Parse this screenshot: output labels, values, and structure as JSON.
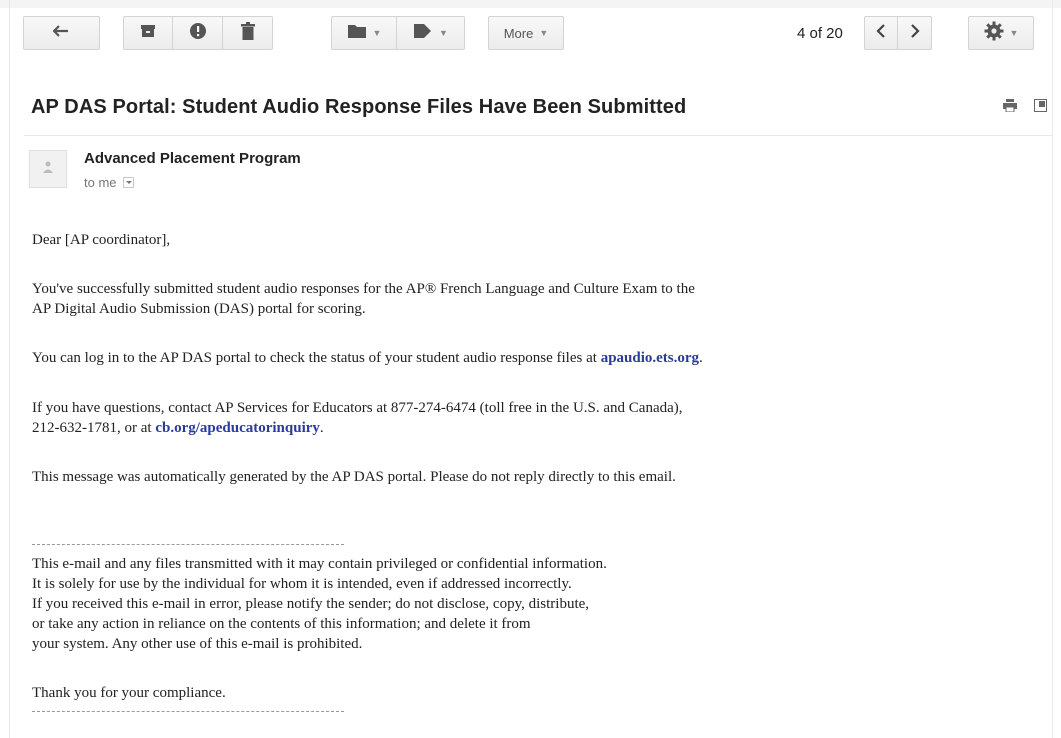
{
  "toolbar": {
    "back_icon": "arrow-left-icon",
    "archive_icon": "archive-icon",
    "spam_icon": "report-spam-icon",
    "delete_icon": "trash-icon",
    "folder_icon": "folder-icon",
    "label_icon": "tag-icon",
    "more_label": "More",
    "pager": "4 of 20",
    "settings_icon": "gear-icon"
  },
  "email": {
    "subject": "AP DAS Portal: Student Audio Response Files Have Been Submitted",
    "sender": "Advanced Placement Program",
    "recipient": "to me",
    "greeting": "Dear [AP coordinator],",
    "para1_line1": "You've successfully submitted student audio responses for the AP® French Language and Culture Exam to the",
    "para1_line2": "AP Digital Audio Submission (DAS) portal for scoring.",
    "para2_text": "You can log in to the AP DAS portal to check the status of your student audio response files at ",
    "para2_link": "apaudio.ets.org",
    "para2_end": ".",
    "para3_line1": "If you have questions, contact AP Services for Educators at 877-274-6474 (toll free in the U.S. and Canada),",
    "para3_line2_start": "212-632-1781, or at ",
    "para3_link": "cb.org/apeducatorinquiry",
    "para3_end": ".",
    "para4": "This message was automatically generated by the AP DAS portal. Please do not reply directly to this email.",
    "disclaimer": [
      "This e-mail and any files transmitted with it may contain privileged or confidential information.",
      "It is solely for use by the individual for whom it is intended, even if addressed incorrectly.",
      "If you received this e-mail in error, please notify the sender; do not disclose, copy, distribute,",
      "or take any action in reliance on the contents of this information; and delete it from",
      "your system. Any other use of this e-mail is prohibited."
    ],
    "thanks": "Thank you for your compliance."
  }
}
